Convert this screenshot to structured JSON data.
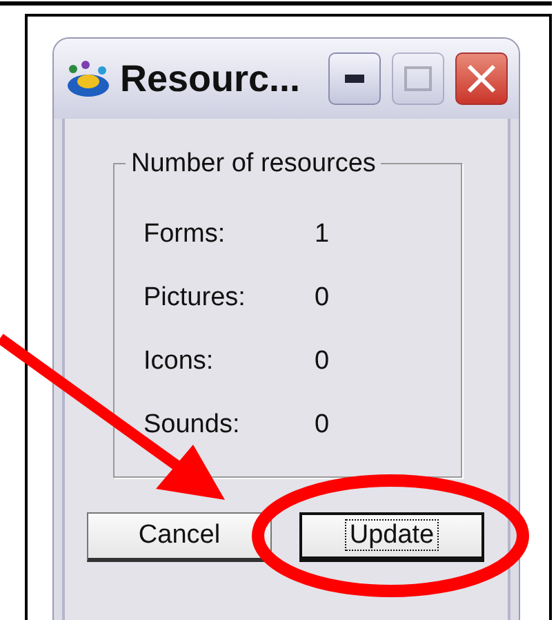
{
  "window": {
    "title": "Resourc...",
    "active": false
  },
  "group": {
    "title": "Number of resources",
    "rows": [
      {
        "label": "Forms:",
        "value": "1"
      },
      {
        "label": "Pictures:",
        "value": "0"
      },
      {
        "label": "Icons:",
        "value": "0"
      },
      {
        "label": "Sounds:",
        "value": "0"
      }
    ]
  },
  "buttons": [
    {
      "label": "Cancel",
      "focused": false
    },
    {
      "label": "Update",
      "focused": true
    }
  ]
}
